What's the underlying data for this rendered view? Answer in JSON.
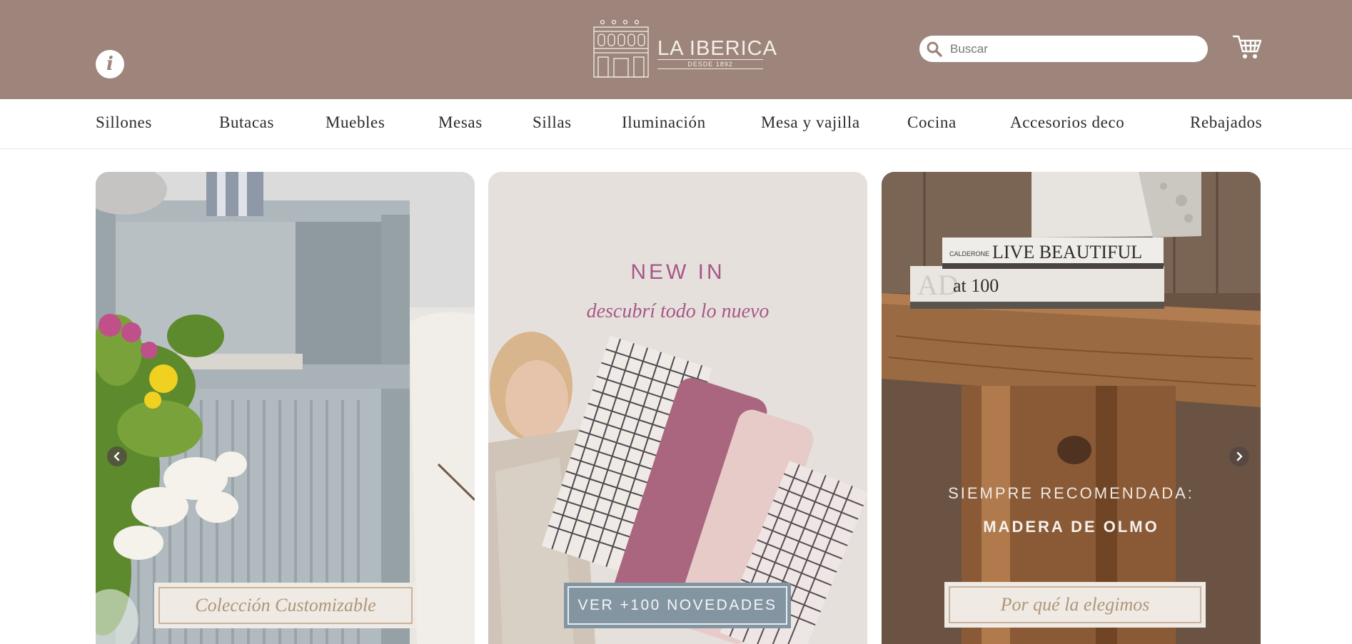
{
  "brand": {
    "name": "LA IBERICA",
    "tagline": "DESDE 1892"
  },
  "header": {
    "info_icon": "info-icon",
    "info_glyph": "i",
    "search_placeholder": "Buscar",
    "search_icon": "search-icon",
    "cart_icon": "cart-icon"
  },
  "colors": {
    "header_bg": "#9d857b",
    "accent_pink": "#a85787",
    "button_gold": "#b09679",
    "button_blue": "#8495a2"
  },
  "nav": {
    "items": [
      {
        "label": "Sillones"
      },
      {
        "label": "Butacas"
      },
      {
        "label": "Muebles"
      },
      {
        "label": "Mesas"
      },
      {
        "label": "Sillas"
      },
      {
        "label": "Iluminación"
      },
      {
        "label": "Mesa y vajilla"
      },
      {
        "label": "Cocina"
      },
      {
        "label": "Accesorios deco"
      },
      {
        "label": "Rebajados"
      }
    ]
  },
  "cards": [
    {
      "button_label": "Colección Customizable"
    },
    {
      "title": "NEW IN",
      "subtitle": "descubrí todo lo nuevo",
      "button_label": "VER +100 NOVEDADES"
    },
    {
      "line1": "SIEMPRE RECOMENDADA:",
      "line2": "MADERA DE OLMO",
      "button_label": "Por qué la elegimos",
      "book1": "LIVE BEAUTIFUL",
      "book1_brand": "CALDERONE",
      "book2": "at 100",
      "book2_prefix": "AD"
    }
  ],
  "carousel": {
    "prev_icon": "chevron-left-icon",
    "next_icon": "chevron-right-icon"
  }
}
